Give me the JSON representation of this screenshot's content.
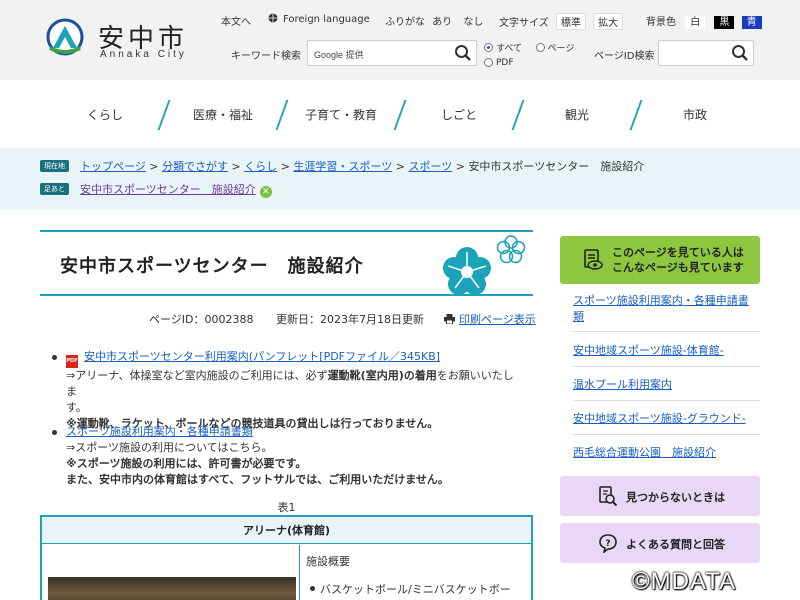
{
  "header": {
    "logo_title": "安中市",
    "logo_sub": "Annaka City",
    "text_link": "本文へ",
    "foreign": "Foreign language",
    "furigana_label": "ふりがな",
    "furigana_on": "あり",
    "furigana_off": "なし",
    "fontsize_label": "文字サイズ",
    "fontsize_std": "標準",
    "fontsize_large": "拡大",
    "bg_label": "背景色",
    "bg_white": "白",
    "bg_black": "黒",
    "bg_blue": "青",
    "keyword_label": "キーワード検索",
    "keyword_placeholder": "Google 提供",
    "scope_all": "すべて",
    "scope_page": "ページ",
    "scope_pdf": "PDF",
    "pageid_label": "ページID検索"
  },
  "nav": [
    "くらし",
    "医療・福祉",
    "子育て・教育",
    "しごと",
    "観光",
    "市政"
  ],
  "breadcrumb": {
    "tag": "現在地",
    "items": [
      "トップページ",
      "分類でさがす",
      "くらし",
      "生涯学習・スポーツ",
      "スポーツ"
    ],
    "sep": ">",
    "current": "安中市スポーツセンター　施設紹介",
    "history_tag": "足あと",
    "history_item": "安中市スポーツセンター　施設紹介"
  },
  "page": {
    "title": "安中市スポーツセンター　施設紹介",
    "page_id": "ページID：0002388",
    "updated": "更新日：2023年7月18日更新",
    "print": "印刷ページ表示"
  },
  "content": {
    "item1_pdf_badge": "PDF",
    "item1_link": "安中市スポーツセンター利用案内(パンフレット[PDFファイル／345KB]",
    "item1_line1a": "⇒アリーナ、体操室など室内施設のご利用には、必ず",
    "item1_line1b": "運動靴(室内用)の着用",
    "item1_line1c": "をお願いいたしま",
    "item1_line2": "す。",
    "item1_note": "※運動靴、ラケット、ボールなどの競技道具の貸出しは行っておりません。",
    "item2_link": "スポーツ施設利用案内・各種申請書類",
    "item2_line1": "⇒スポーツ施設の利用についてはこちら。",
    "item2_note1": "※スポーツ施設の利用には、許可書が必要です。",
    "item2_note2": "また、安中市内の体育館はすべて、フットサルでは、ご利用いただけません。"
  },
  "table": {
    "caption": "表1",
    "header": "アリーナ(体育館)",
    "cell_label": "施設概要",
    "item1": "バスケットボール/ミニバスケットボー"
  },
  "sidebar": {
    "head_line1": "このページを見ている人は",
    "head_line2": "こんなページも見ています",
    "links": [
      "スポーツ施設利用案内・各種申請書類",
      "安中地域スポーツ施設-体育館-",
      "温水プール利用案内",
      "安中地域スポーツ施設-グラウンド-",
      "西毛総合運動公園　施設紹介"
    ],
    "btn_notfound": "見つからないときは",
    "btn_faq": "よくある質問と回答"
  },
  "watermark": "©MDATA"
}
